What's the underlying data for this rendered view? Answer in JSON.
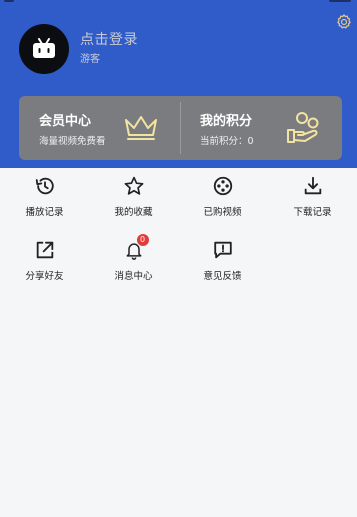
{
  "header": {
    "login_title": "点击登录",
    "login_subtitle": "游客",
    "background_color": "#2f5cc9"
  },
  "member_card": {
    "vip_title": "会员中心",
    "vip_subtitle": "海量视频免费看",
    "points_title": "我的积分",
    "points_label": "当前积分：",
    "points_value": "0",
    "icon_color": "#f3e3a0"
  },
  "menu": {
    "items": [
      {
        "label": "播放记录",
        "icon": "history-icon"
      },
      {
        "label": "我的收藏",
        "icon": "star-icon"
      },
      {
        "label": "已购视频",
        "icon": "film-reel-icon"
      },
      {
        "label": "下载记录",
        "icon": "download-icon"
      },
      {
        "label": "分享好友",
        "icon": "share-icon"
      },
      {
        "label": "消息中心",
        "icon": "bell-icon",
        "badge": "0"
      },
      {
        "label": "意见反馈",
        "icon": "feedback-icon"
      }
    ]
  }
}
